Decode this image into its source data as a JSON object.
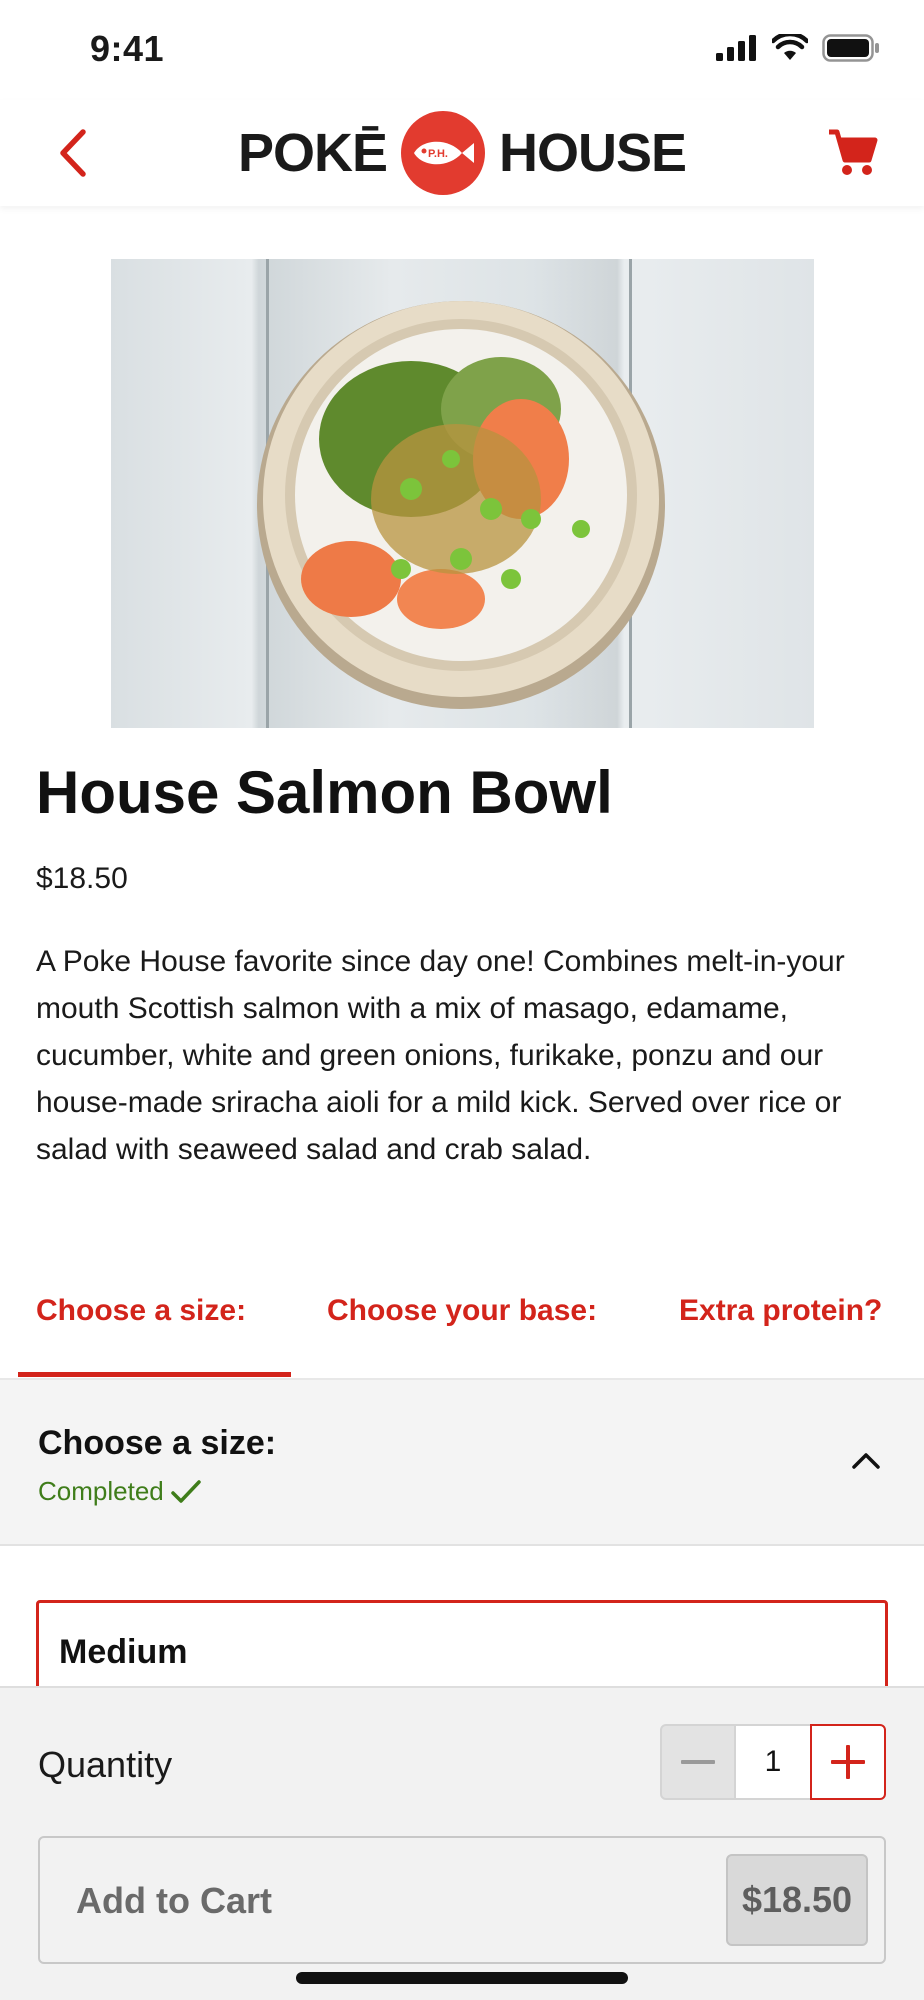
{
  "status_bar": {
    "time": "9:41",
    "icons": [
      "signal-icon",
      "wifi-icon",
      "battery-icon"
    ]
  },
  "header": {
    "back_icon": "chevron-left-icon",
    "logo_left": "POKĒ",
    "logo_right": "HOUSE",
    "logo_fish_text": "P.H.",
    "cart_icon": "cart-icon",
    "accent_color": "#d3241b"
  },
  "product": {
    "image_alt": "poke bowl photo",
    "title": "House Salmon Bowl",
    "price": "$18.50",
    "description": "A Poke House favorite since day one! Combines melt-in-your mouth Scottish salmon with a mix of masago, edamame, cucumber, white and green onions, furikake, ponzu and our house-made sriracha aioli for a mild kick. Served over rice or salad with seaweed salad and crab salad."
  },
  "tabs": [
    {
      "label": "Choose a size:",
      "active": true
    },
    {
      "label": "Choose your base:",
      "active": false
    },
    {
      "label": "Extra protein?",
      "active": false
    }
  ],
  "section": {
    "title": "Choose a size:",
    "status": "Completed",
    "status_icon": "checkmark-icon",
    "toggle_icon": "chevron-up-icon",
    "status_color": "#3f7d1a"
  },
  "options": [
    {
      "label": "Medium",
      "selected": true
    }
  ],
  "bottom_bar": {
    "quantity_label": "Quantity",
    "quantity_value": "1",
    "minus_icon": "minus-icon",
    "plus_icon": "plus-icon",
    "add_to_cart_label": "Add to Cart",
    "add_to_cart_price": "$18.50"
  }
}
